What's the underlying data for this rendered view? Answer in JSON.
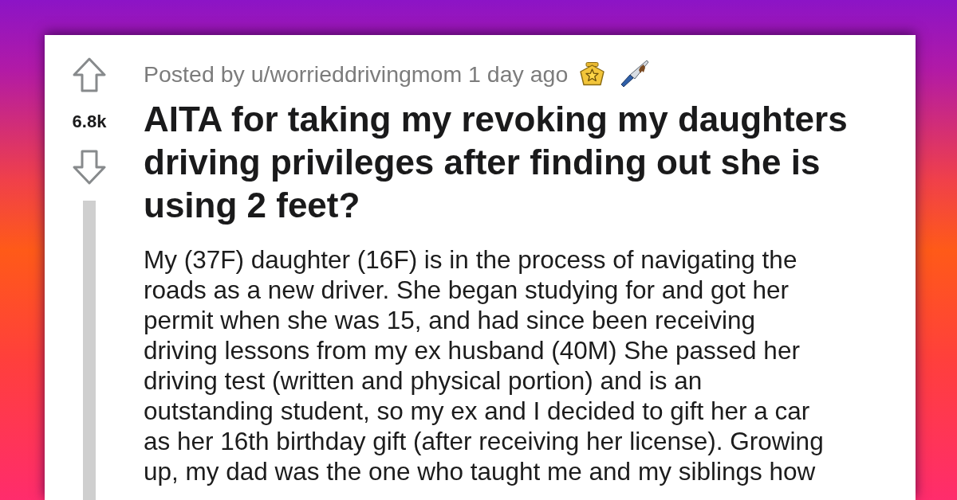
{
  "post": {
    "score": "6.8k",
    "byline": "Posted by u/worrieddrivingmom 1 day ago",
    "title": "AITA for taking my revoking my daughters driving privileges after finding out she is using 2 feet?",
    "body": "My (37F) daughter (16F) is in the process of navigating the roads as a new driver. She began studying for and got her permit when she was 15, and had since been receiving driving lessons from my ex husband (40M) She passed her driving test (written and physical portion) and is an outstanding student, so my ex and I decided to gift her a car as her 16th birthday gift (after receiving her license). Growing up, my dad was the one who taught me and my siblings how"
  }
}
